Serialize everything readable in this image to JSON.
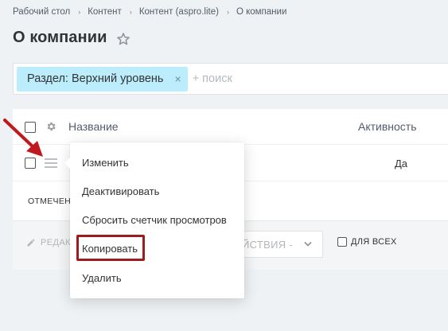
{
  "breadcrumb": {
    "items": [
      "Рабочий стол",
      "Контент",
      "Контент (aspro.lite)",
      "О компании"
    ],
    "separator": "›"
  },
  "page": {
    "title": "О компании"
  },
  "filter": {
    "chip_label": "Раздел: Верхний уровень",
    "chip_close": "×",
    "search_placeholder": "+ поиск"
  },
  "grid": {
    "columns": {
      "name": "Название",
      "active": "Активность"
    },
    "rows": [
      {
        "active": "Да"
      }
    ],
    "selected_label": "ОТМЕЧЕН",
    "edit_label": "РЕДАК",
    "actions_placeholder": "ЙСТВИЯ -",
    "for_all_label": "ДЛЯ ВСЕХ"
  },
  "context_menu": {
    "items": [
      "Изменить",
      "Деактивировать",
      "Сбросить счетчик просмотров",
      "Копировать",
      "Удалить"
    ],
    "highlighted": "Копировать"
  },
  "colors": {
    "background": "#eef2f4",
    "chip": "#bcedfc",
    "highlight": "#9c1d1f",
    "arrow": "#c0191d"
  }
}
